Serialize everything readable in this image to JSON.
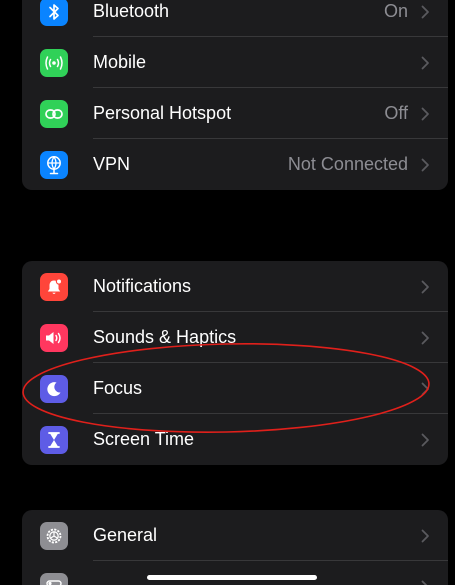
{
  "groups": [
    {
      "rows": [
        {
          "label": "Bluetooth",
          "value": "On",
          "icon": "bluetooth-icon",
          "color": "#0a84ff"
        },
        {
          "label": "Mobile",
          "value": "",
          "icon": "antenna-icon",
          "color": "#30d158"
        },
        {
          "label": "Personal Hotspot",
          "value": "Off",
          "icon": "hotspot-icon",
          "color": "#30d158"
        },
        {
          "label": "VPN",
          "value": "Not Connected",
          "icon": "vpn-icon",
          "color": "#0a84ff"
        }
      ]
    },
    {
      "rows": [
        {
          "label": "Notifications",
          "value": "",
          "icon": "bell-icon",
          "color": "#ff453a"
        },
        {
          "label": "Sounds & Haptics",
          "value": "",
          "icon": "speaker-icon",
          "color": "#ff375f"
        },
        {
          "label": "Focus",
          "value": "",
          "icon": "moon-icon",
          "color": "#5e5ce6"
        },
        {
          "label": "Screen Time",
          "value": "",
          "icon": "hourglass-icon",
          "color": "#5e5ce6"
        }
      ]
    },
    {
      "rows": [
        {
          "label": "General",
          "value": "",
          "icon": "gear-icon",
          "color": "#8e8e93"
        },
        {
          "label": "",
          "value": "",
          "icon": "toggles-icon",
          "color": "#8e8e93"
        }
      ]
    }
  ],
  "colors": {
    "background": "#000000",
    "row_background": "#1c1c1e",
    "annotation": "#ff0000",
    "value_text": "#8d8d93"
  }
}
